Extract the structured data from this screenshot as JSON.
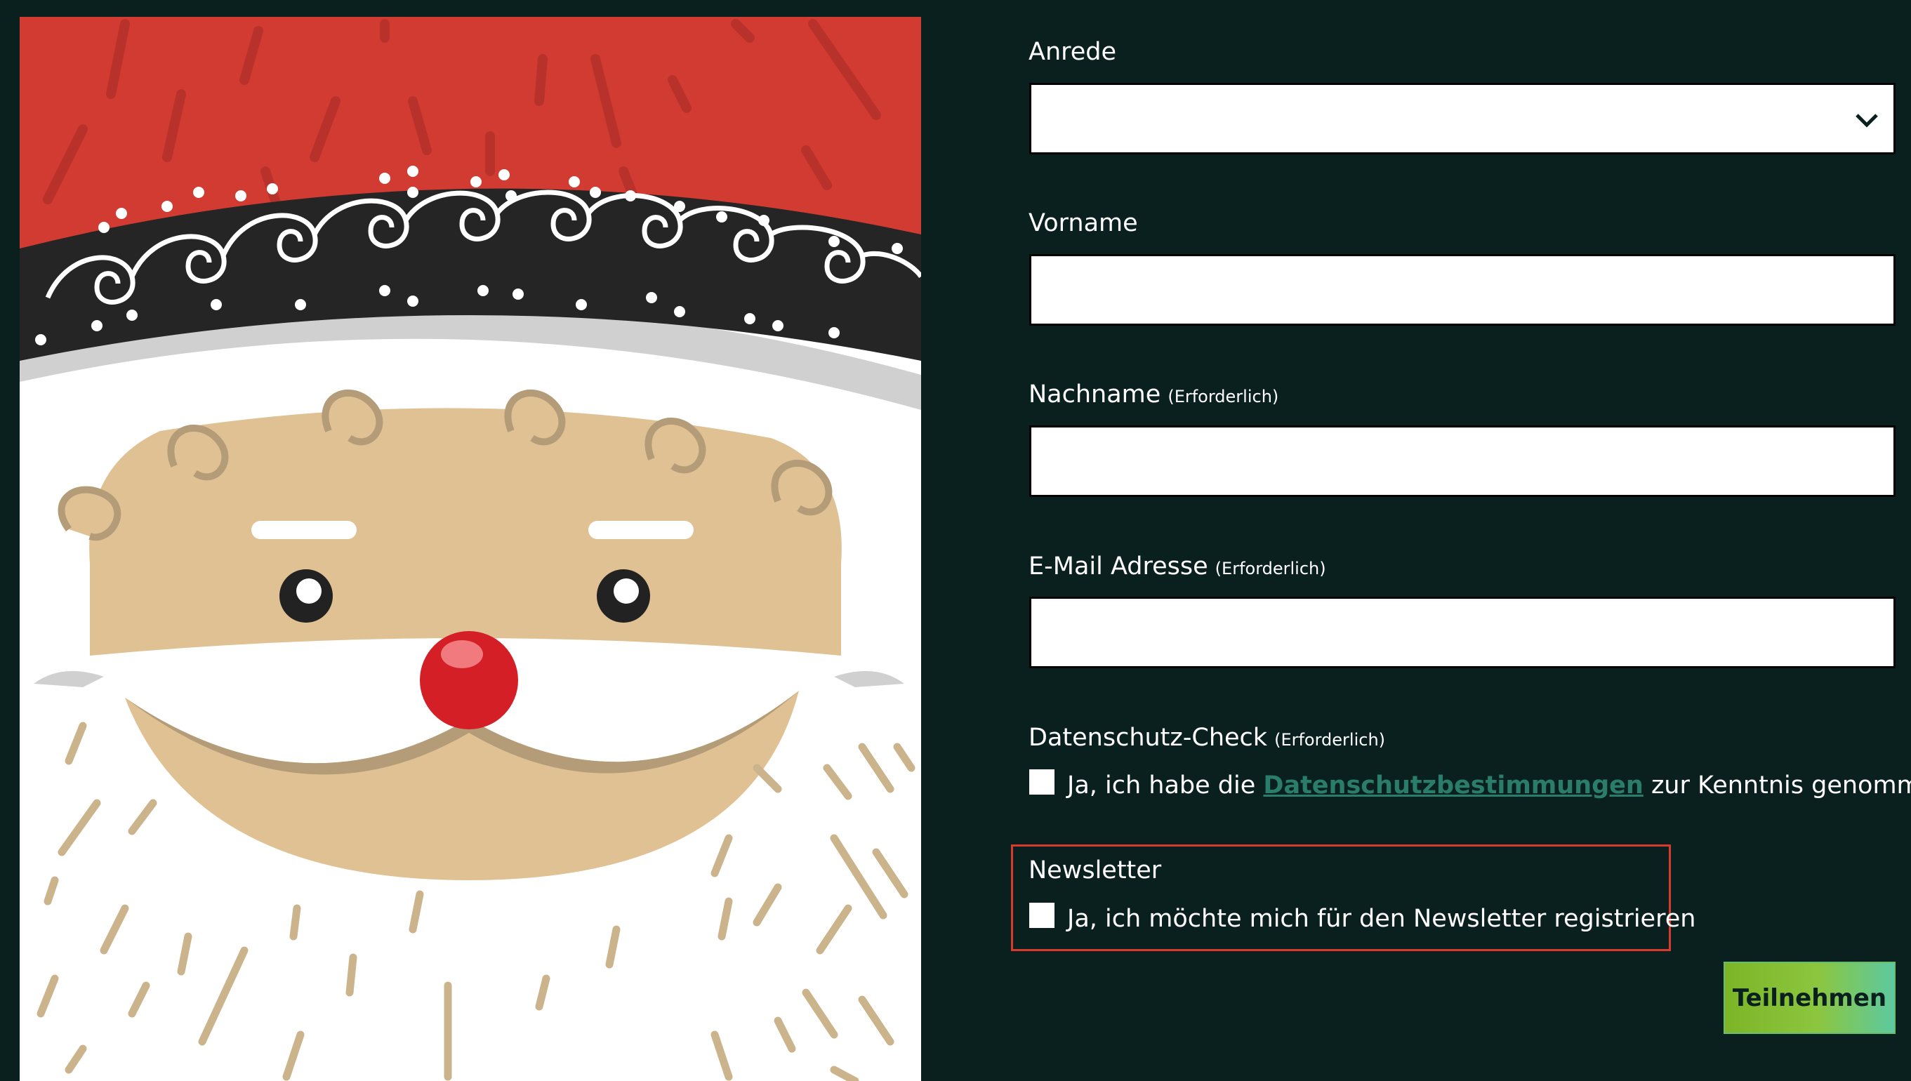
{
  "form": {
    "salutation": {
      "label": "Anrede",
      "value": ""
    },
    "firstname": {
      "label": "Vorname",
      "value": ""
    },
    "lastname": {
      "label": "Nachname",
      "required": "(Erforderlich)",
      "value": ""
    },
    "email": {
      "label": "E-Mail Adresse",
      "required": "(Erforderlich)",
      "value": ""
    },
    "privacy": {
      "label": "Datenschutz-Check",
      "required": "(Erforderlich)",
      "checked": false,
      "text_before": "Ja, ich habe die ",
      "link_text": "Datenschutzbestimmungen",
      "text_after": " zur Kenntnis genommen."
    },
    "newsletter": {
      "label": "Newsletter",
      "checked": false,
      "text": "Ja, ich möchte mich für den Newsletter registrieren"
    },
    "submit_label": "Teilnehmen"
  },
  "colors": {
    "background": "#0a201f",
    "accent_link": "#2a7d6a",
    "highlight_border": "#d93a2b",
    "button_gradient": [
      "#7cb526",
      "#5cc9a0"
    ]
  },
  "illustration": "santa-face"
}
